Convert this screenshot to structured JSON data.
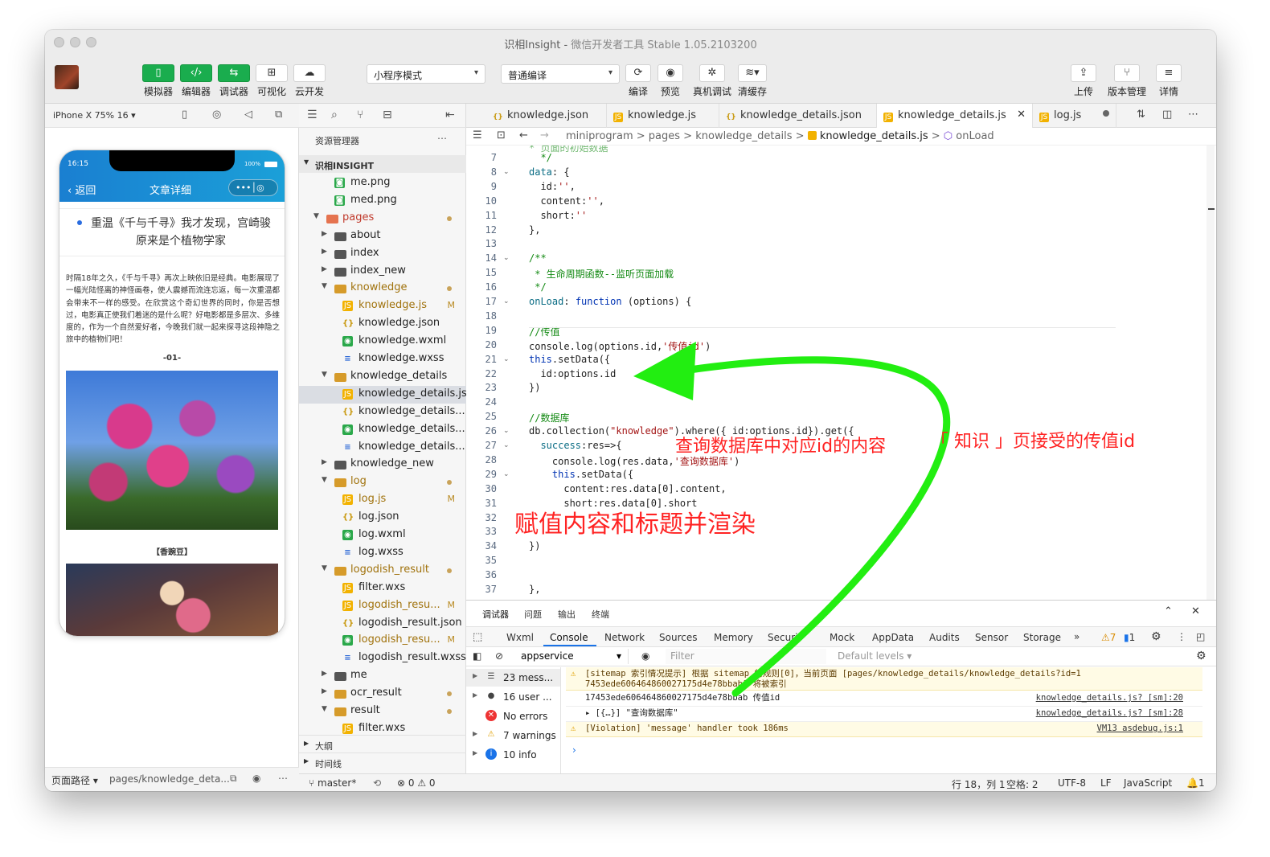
{
  "window": {
    "title": "识相Insight",
    "title_sep": " - ",
    "subtitle": "微信开发者工具 Stable 1.05.2103200"
  },
  "toolbar": {
    "left_buttons": [
      "模拟器",
      "编辑器",
      "调试器",
      "可视化",
      "云开发"
    ],
    "mode_select": "小程序模式",
    "compile_select": "普通编译",
    "mid_buttons": [
      "编译",
      "预览",
      "真机调试",
      "清缓存"
    ],
    "right_buttons": [
      "上传",
      "版本管理",
      "详情"
    ]
  },
  "simulator": {
    "device": "iPhone X 75% 16",
    "status_time": "16:15",
    "battery": "100%",
    "nav_back": "返回",
    "nav_title": "文章详细",
    "article_title": "重温《千与千寻》我才发现，宫崎骏原来是个植物学家",
    "article_body": "时隔18年之久，《千与千寻》再次上映依旧是经典。电影展现了一幅光陆怪离的神怪画卷，使人震撼而流连忘返，每一次重温都会带来不一样的感受。在欣赏这个奇幻世界的同时，你是否想过，电影真正使我们着迷的是什么呢？好电影都是多层次、多维度的，作为一个自然爱好者，今晚我们就一起来探寻这段神隐之旅中的植物们吧！",
    "section_no": "-01-",
    "caption": "【香豌豆】",
    "footer_label": "页面路径",
    "footer_path": "pages/knowledge_deta..."
  },
  "explorer": {
    "header": "资源管理器",
    "project": "识相INSIGHT",
    "items": [
      {
        "label": "me.png",
        "icon": "png"
      },
      {
        "label": "med.png",
        "icon": "png"
      },
      {
        "label": "pages",
        "icon": "dir-r",
        "open": true,
        "dot": true
      },
      {
        "label": "about",
        "icon": "dir"
      },
      {
        "label": "index",
        "icon": "dir"
      },
      {
        "label": "index_new",
        "icon": "dir"
      },
      {
        "label": "knowledge",
        "icon": "dir-o",
        "open": true,
        "dot": true
      },
      {
        "label": "knowledge.js",
        "icon": "js",
        "status": "M"
      },
      {
        "label": "knowledge.json",
        "icon": "json"
      },
      {
        "label": "knowledge.wxml",
        "icon": "wxml"
      },
      {
        "label": "knowledge.wxss",
        "icon": "wxss"
      },
      {
        "label": "knowledge_details",
        "icon": "dir-o",
        "open": true
      },
      {
        "label": "knowledge_details.js",
        "icon": "js",
        "selected": true
      },
      {
        "label": "knowledge_details....",
        "icon": "json"
      },
      {
        "label": "knowledge_details....",
        "icon": "wxml"
      },
      {
        "label": "knowledge_details....",
        "icon": "wxss"
      },
      {
        "label": "knowledge_new",
        "icon": "dir"
      },
      {
        "label": "log",
        "icon": "dir-o",
        "open": true,
        "dot": true
      },
      {
        "label": "log.js",
        "icon": "js",
        "status": "M"
      },
      {
        "label": "log.json",
        "icon": "json"
      },
      {
        "label": "log.wxml",
        "icon": "wxml"
      },
      {
        "label": "log.wxss",
        "icon": "wxss"
      },
      {
        "label": "logodish_result",
        "icon": "dir-o",
        "open": true,
        "dot": true
      },
      {
        "label": "filter.wxs",
        "icon": "js"
      },
      {
        "label": "logodish_resu...",
        "icon": "js",
        "status": "M"
      },
      {
        "label": "logodish_result.json",
        "icon": "json"
      },
      {
        "label": "logodish_resu...",
        "icon": "wxml",
        "status": "M"
      },
      {
        "label": "logodish_result.wxss",
        "icon": "wxss"
      },
      {
        "label": "me",
        "icon": "dir"
      },
      {
        "label": "ocr_result",
        "icon": "dir-o",
        "dot": true
      },
      {
        "label": "result",
        "icon": "dir-o",
        "open": true,
        "dot": true
      },
      {
        "label": "filter.wxs",
        "icon": "js"
      }
    ],
    "outline": "大纲",
    "timeline": "时间线"
  },
  "editor": {
    "tabs": [
      {
        "label": "knowledge.json",
        "icon": "json"
      },
      {
        "label": "knowledge.js",
        "icon": "js"
      },
      {
        "label": "knowledge_details.json",
        "icon": "json"
      },
      {
        "label": "knowledge_details.js",
        "icon": "js",
        "active": true
      },
      {
        "label": "log.js",
        "icon": "js"
      }
    ],
    "breadcrumb": [
      "miniprogram",
      "pages",
      "knowledge_details",
      "knowledge_details.js",
      "onLoad"
    ],
    "lines": [
      {
        "n": "7",
        "t": "  */"
      },
      {
        "n": "8",
        "t": "data: {"
      },
      {
        "n": "9",
        "t": "  id:'',"
      },
      {
        "n": "10",
        "t": "  content:'',"
      },
      {
        "n": "11",
        "t": "  short:''"
      },
      {
        "n": "12",
        "t": "},"
      },
      {
        "n": "13",
        "t": ""
      },
      {
        "n": "14",
        "t": "/**"
      },
      {
        "n": "15",
        "t": " * 生命周期函数--监听页面加载"
      },
      {
        "n": "16",
        "t": " */"
      },
      {
        "n": "17",
        "t": "onLoad: function (options) {"
      },
      {
        "n": "18",
        "t": ""
      },
      {
        "n": "19",
        "t": "//传值"
      },
      {
        "n": "20",
        "t": "console.log(options.id,'传值id')"
      },
      {
        "n": "21",
        "t": "this.setData({"
      },
      {
        "n": "22",
        "t": "  id:options.id"
      },
      {
        "n": "23",
        "t": "})"
      },
      {
        "n": "24",
        "t": ""
      },
      {
        "n": "25",
        "t": "//数据库"
      },
      {
        "n": "26",
        "t": "db.collection(\"knowledge\").where({ id:options.id}).get({"
      },
      {
        "n": "27",
        "t": "  success:res=>{"
      },
      {
        "n": "28",
        "t": "    console.log(res.data,'查询数据库')"
      },
      {
        "n": "29",
        "t": "    this.setData({"
      },
      {
        "n": "30",
        "t": "      content:res.data[0].content,"
      },
      {
        "n": "31",
        "t": "      short:res.data[0].short"
      },
      {
        "n": "32",
        "t": ""
      },
      {
        "n": "33",
        "t": ""
      },
      {
        "n": "34",
        "t": "})"
      },
      {
        "n": "35",
        "t": ""
      },
      {
        "n": "36",
        "t": ""
      },
      {
        "n": "37",
        "t": "},"
      }
    ]
  },
  "annotations": {
    "query": "查询数据库中对应id的内容",
    "receive": "「 知识 」页接受的传值id",
    "assign": "赋值内容和标题并渲染",
    "color": "#ff2323",
    "arrow_color": "#22ee11"
  },
  "devtools": {
    "top_tabs": [
      "调试器",
      "问题",
      "输出",
      "终端"
    ],
    "panels": [
      "Wxml",
      "Console",
      "Network",
      "Sources",
      "Memory",
      "Securi",
      "Mock",
      "AppData",
      "Audits",
      "Sensor",
      "Storage"
    ],
    "active_panel": "Console",
    "warn_count": "7",
    "info_count": "1",
    "context": "appservice",
    "filter_placeholder": "Filter",
    "levels": "Default levels",
    "sidebar": [
      {
        "label": "23 mess...",
        "icon": "list"
      },
      {
        "label": "16 user ...",
        "icon": "user"
      },
      {
        "label": "No errors",
        "icon": "error"
      },
      {
        "label": "7 warnings",
        "icon": "warn"
      },
      {
        "label": "10 info",
        "icon": "info"
      }
    ],
    "messages": [
      {
        "type": "warn",
        "text": "[sitemap 索引情况提示] 根据 sitemap 的规则[0]，当前页面 [pages/knowledge_details/knowledge_details?id=17453ede606464860027175d4e78bbab] 将被索引",
        "src": ""
      },
      {
        "type": "log",
        "text": "17453ede606464860027175d4e78bbab 传值id",
        "src": "knowledge_details.js? [sm]:20"
      },
      {
        "type": "log",
        "text": "▸ [{…}] \"查询数据库\"",
        "src": "knowledge_details.js? [sm]:28"
      },
      {
        "type": "warn",
        "text": "[Violation] 'message' handler took 186ms",
        "src": "VM13 asdebug.js:1"
      }
    ]
  },
  "statusbar": {
    "branch": "master*",
    "errors": "0",
    "warnings": "0",
    "position": "行 18，列 1",
    "spaces": "空格: 2",
    "encoding": "UTF-8",
    "eol": "LF",
    "language": "JavaScript",
    "notifications": "1"
  }
}
